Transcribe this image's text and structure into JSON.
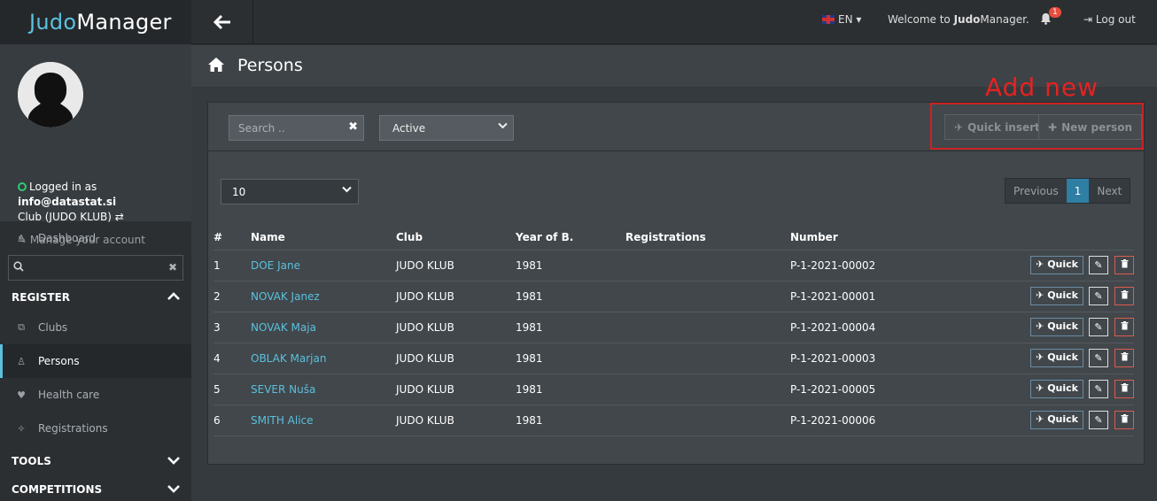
{
  "brand": {
    "part1": "Judo",
    "part2": "Manager"
  },
  "colors": {
    "accent": "#5bc0de",
    "annotation": "#e52222",
    "danger": "#e05a4e"
  },
  "profile": {
    "status": "Logged in as",
    "email": "info@datastat.si",
    "club": "Club (JUDO KLUB)",
    "manage": "Manage your account"
  },
  "sidebar": {
    "dashboard": "Dashboard",
    "search_placeholder": "",
    "sections": [
      {
        "label": "REGISTER",
        "expanded": true
      },
      {
        "label": "TOOLS",
        "expanded": false
      },
      {
        "label": "COMPETITIONS",
        "expanded": false
      }
    ],
    "register_items": [
      {
        "label": "Clubs",
        "icon": "external-link-icon"
      },
      {
        "label": "Persons",
        "icon": "user-icon",
        "active": true
      },
      {
        "label": "Health care",
        "icon": "heart-icon"
      },
      {
        "label": "Registrations",
        "icon": "pin-icon"
      }
    ]
  },
  "topbar": {
    "language": "EN",
    "welcome_prefix": "Welcome to ",
    "welcome_bold": "Judo",
    "welcome_suffix": "Manager.",
    "notifications": "1",
    "logout": "Log out"
  },
  "page": {
    "title": "Persons"
  },
  "filters": {
    "search_placeholder": "Search ..",
    "status_value": "Active",
    "page_size": "10"
  },
  "annotation": {
    "label": "Add new"
  },
  "actions": {
    "quick_insert": "Quick insert",
    "new_person": "New person"
  },
  "pager": {
    "previous": "Previous",
    "current": "1",
    "next": "Next"
  },
  "table": {
    "headers": [
      "#",
      "Name",
      "Club",
      "Year of B.",
      "Registrations",
      "Number"
    ],
    "quick_label": "Quick",
    "rows": [
      {
        "n": "1",
        "name": "DOE Jane",
        "club": "JUDO KLUB",
        "year": "1981",
        "reg": "",
        "number": "P-1-2021-00002"
      },
      {
        "n": "2",
        "name": "NOVAK Janez",
        "club": "JUDO KLUB",
        "year": "1981",
        "reg": "",
        "number": "P-1-2021-00001"
      },
      {
        "n": "3",
        "name": "NOVAK Maja",
        "club": "JUDO KLUB",
        "year": "1981",
        "reg": "",
        "number": "P-1-2021-00004"
      },
      {
        "n": "4",
        "name": "OBLAK Marjan",
        "club": "JUDO KLUB",
        "year": "1981",
        "reg": "",
        "number": "P-1-2021-00003"
      },
      {
        "n": "5",
        "name": "SEVER Nuša",
        "club": "JUDO KLUB",
        "year": "1981",
        "reg": "",
        "number": "P-1-2021-00005"
      },
      {
        "n": "6",
        "name": "SMITH Alice",
        "club": "JUDO KLUB",
        "year": "1981",
        "reg": "",
        "number": "P-1-2021-00006"
      }
    ]
  }
}
